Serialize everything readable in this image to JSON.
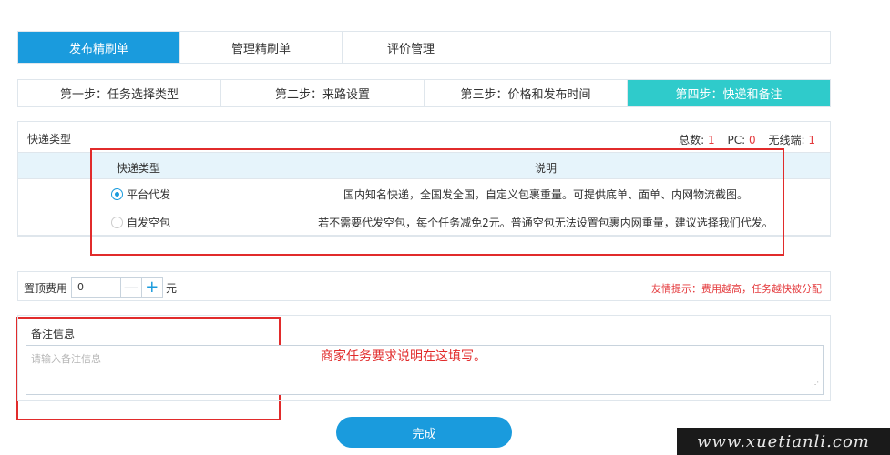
{
  "top_tabs": [
    {
      "label": "发布精刷单",
      "active": true
    },
    {
      "label": "管理精刷单",
      "active": false
    },
    {
      "label": "评价管理",
      "active": false
    }
  ],
  "steps": [
    {
      "label": "第一步：任务选择类型",
      "active": false
    },
    {
      "label": "第二步：来路设置",
      "active": false
    },
    {
      "label": "第三步：价格和发布时间",
      "active": false
    },
    {
      "label": "第四步：快递和备注",
      "active": true
    }
  ],
  "courier": {
    "title": "快递类型",
    "stats": {
      "total_label": "总数:",
      "total_value": "1",
      "pc_label": "PC:",
      "pc_value": "0",
      "wireless_label": "无线端:",
      "wireless_value": "1"
    },
    "columns": {
      "type": "快递类型",
      "desc": "说明"
    },
    "rows": [
      {
        "type": "平台代发",
        "desc": "国内知名快递，全国发全国，自定义包裹重量。可提供底单、面单、内网物流截图。",
        "selected": true
      },
      {
        "type": "自发空包",
        "desc": "若不需要代发空包，每个任务减免2元。普通空包无法设置包裹内网重量，建议选择我们代发。",
        "selected": false
      }
    ]
  },
  "fee": {
    "label": "置顶费用",
    "value": "0",
    "minus": "—",
    "plus": "+",
    "unit": "元",
    "hint": "友情提示：费用越高，任务越快被分配"
  },
  "remark": {
    "title": "备注信息",
    "placeholder": "请输入备注信息",
    "annotation": "商家任务要求说明在这填写。"
  },
  "finish_label": "完成",
  "watermark": "www.xuetianli.com",
  "colors": {
    "primary": "#1a9bdd",
    "step_active": "#2fcbcb",
    "highlight_red": "#e12b2b"
  }
}
